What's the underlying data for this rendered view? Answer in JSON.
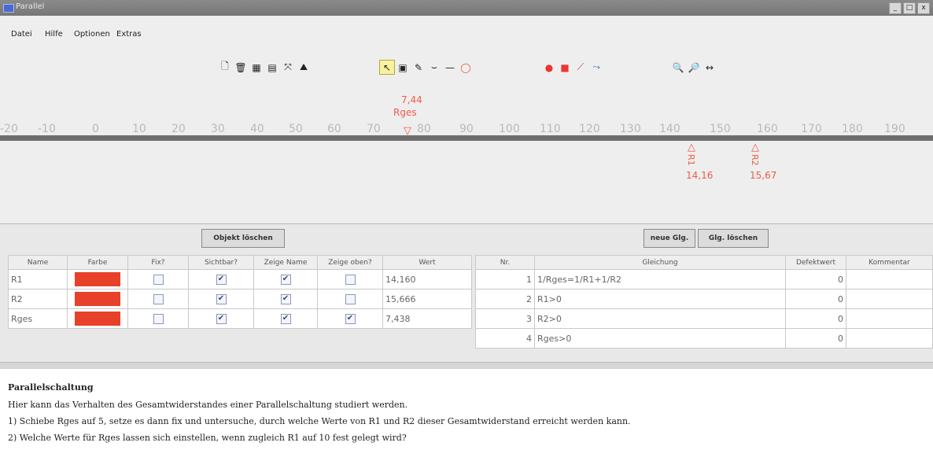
{
  "window": {
    "title": "Parallel"
  },
  "menu": [
    "Datei",
    "Hilfe",
    "Optionen",
    "Extras"
  ],
  "toolbar": {
    "icons": [
      "new-file-icon",
      "trash-icon",
      "grid-icon",
      "axis-icon",
      "move-icon",
      "chart-icon",
      "pointer-icon",
      "select-icon",
      "edit-icon",
      "curve-icon",
      "line-icon",
      "circle-icon",
      "point-icon",
      "square-point-icon",
      "line-segment-icon",
      "polyline-icon",
      "zoom-in-icon",
      "zoom-out-icon",
      "fit-icon"
    ]
  },
  "ruler": {
    "ticks": [
      "-20",
      "-10",
      "0",
      "10",
      "20",
      "30",
      "40",
      "50",
      "60",
      "70",
      "80",
      "90",
      "100",
      "110",
      "120",
      "130",
      "140",
      "150",
      "160",
      "170",
      "180",
      "190"
    ],
    "markers": [
      {
        "name": "Rges",
        "value": "7,44"
      },
      {
        "name": "R1",
        "value": "14,16"
      },
      {
        "name": "R2",
        "value": "15,67"
      }
    ]
  },
  "buttons": {
    "delete_object": "Objekt löschen",
    "new_equation": "neue Glg.",
    "delete_equation": "Glg. löschen"
  },
  "object_table": {
    "headers": [
      "Name",
      "Farbe",
      "Fix?",
      "Sichtbar?",
      "Zeige Name",
      "Zeige oben?",
      "Wert"
    ],
    "rows": [
      {
        "name": "R1",
        "color": "#e8412a",
        "fix": false,
        "visible": true,
        "show_name": true,
        "show_top": false,
        "value": "14,160"
      },
      {
        "name": "R2",
        "color": "#e8412a",
        "fix": false,
        "visible": true,
        "show_name": true,
        "show_top": false,
        "value": "15,666"
      },
      {
        "name": "Rges",
        "color": "#e8412a",
        "fix": false,
        "visible": true,
        "show_name": true,
        "show_top": true,
        "value": "7,438"
      }
    ]
  },
  "equation_table": {
    "headers": [
      "Nr.",
      "Gleichung",
      "Defektwert",
      "Kommentar"
    ],
    "rows": [
      {
        "nr": "1",
        "equation": "1/Rges=1/R1+1/R2",
        "defect": "0",
        "comment": ""
      },
      {
        "nr": "2",
        "equation": "R1>0",
        "defect": "0",
        "comment": ""
      },
      {
        "nr": "3",
        "equation": "R2>0",
        "defect": "0",
        "comment": ""
      },
      {
        "nr": "4",
        "equation": "Rges>0",
        "defect": "0",
        "comment": ""
      }
    ]
  },
  "description": {
    "heading": "Parallelschaltung",
    "lines": [
      "Hier kann das Verhalten des Gesamtwiderstandes einer Parallelschaltung studiert werden.",
      "1) Schiebe Rges auf 5, setze es dann fix und untersuche, durch welche Werte von R1 und R2 dieser Gesamtwiderstand erreicht werden kann.",
      "2) Welche Werte für Rges lassen sich einstellen, wenn zugleich R1 auf 10 fest gelegt wird?"
    ]
  },
  "colors": {
    "accent_red": "#ef5b44",
    "swatch_red": "#e8412a",
    "axis": "#6d6d6d"
  }
}
